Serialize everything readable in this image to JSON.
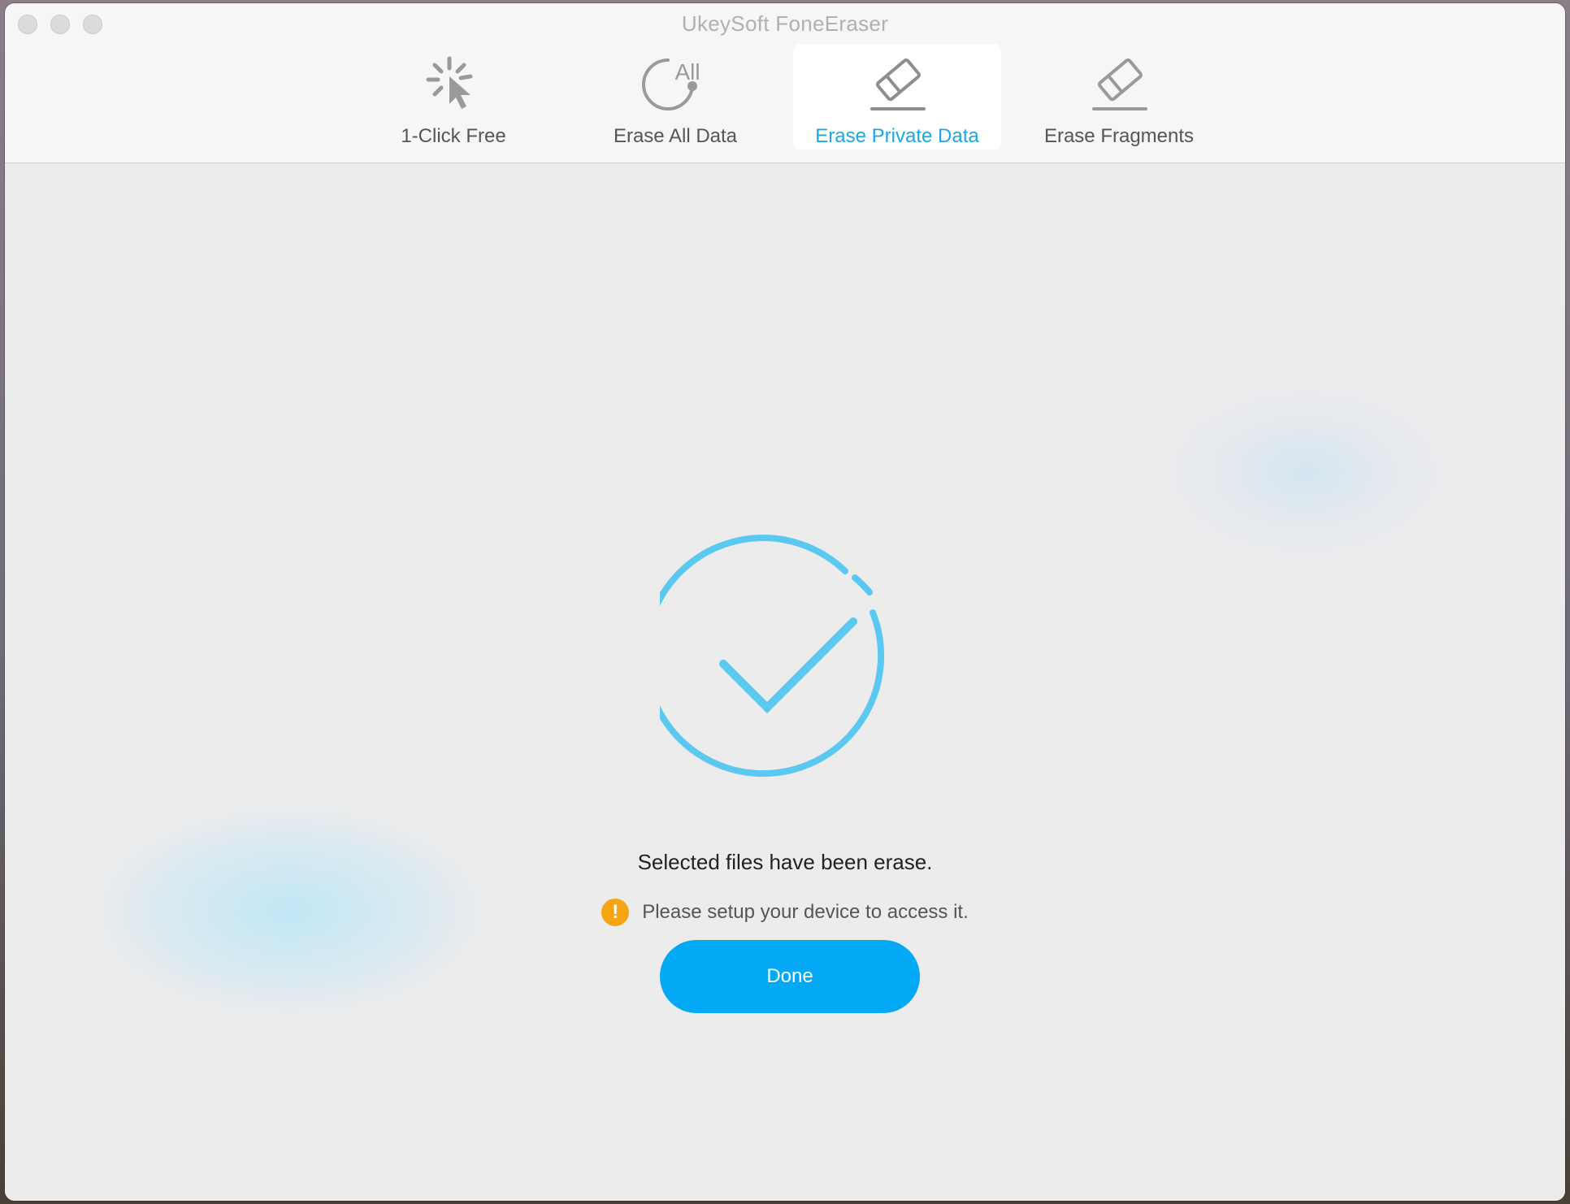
{
  "window": {
    "title": "UkeySoft FoneEraser"
  },
  "tabs": [
    {
      "label": "1-Click Free",
      "icon": "cursor-click-icon",
      "active": false
    },
    {
      "label": "Erase All Data",
      "icon": "erase-all-icon",
      "icon_text": "All",
      "active": false
    },
    {
      "label": "Erase Private Data",
      "icon": "eraser-icon",
      "active": true
    },
    {
      "label": "Erase Fragments",
      "icon": "eraser-icon",
      "active": false
    }
  ],
  "result": {
    "icon": "success-check-icon",
    "message": "Selected files have been erase.",
    "warning": {
      "icon": "warning-icon",
      "icon_glyph": "!",
      "text": "Please setup your device to access it."
    },
    "done_label": "Done"
  },
  "colors": {
    "accent": "#1aa7e4",
    "button": "#03a9f4",
    "check": "#5bc8f0",
    "warning": "#f5a511"
  }
}
